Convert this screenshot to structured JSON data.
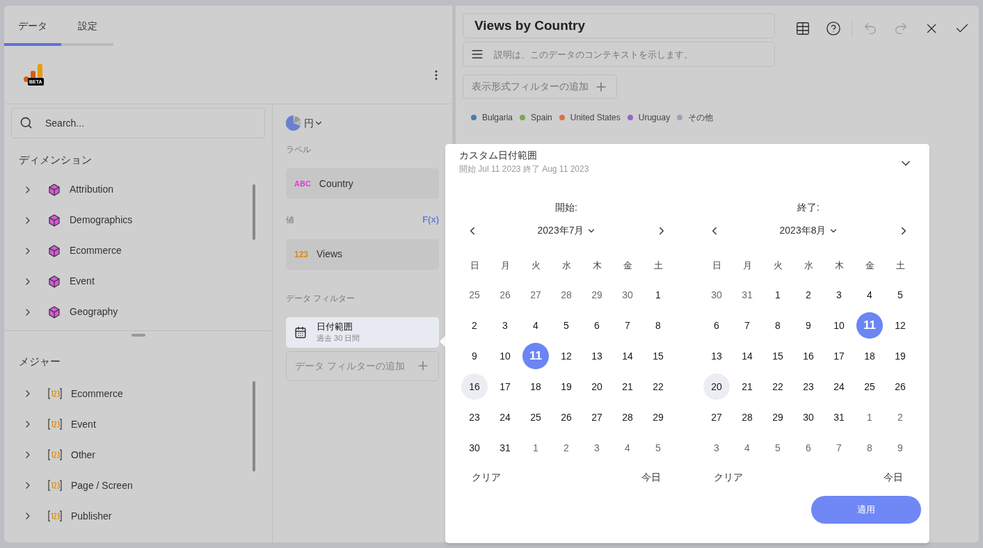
{
  "tabs": [
    {
      "label": "データ",
      "selected": true
    },
    {
      "label": "設定",
      "selected": false
    }
  ],
  "source": {
    "badge": "BETA"
  },
  "search": {
    "placeholder": "Search..."
  },
  "dimensions": {
    "title": "ディメンション",
    "items": [
      {
        "label": "Attribution",
        "expanded": false
      },
      {
        "label": "Demographics",
        "expanded": false
      },
      {
        "label": "Ecommerce",
        "expanded": false
      },
      {
        "label": "Event",
        "expanded": false
      },
      {
        "label": "Geography",
        "expanded": false
      }
    ]
  },
  "measures": {
    "title": "メジャー",
    "items": [
      {
        "label": "Ecommerce",
        "expanded": false
      },
      {
        "label": "Event",
        "expanded": false
      },
      {
        "label": "Other",
        "expanded": false
      },
      {
        "label": "Page / Screen",
        "expanded": false
      },
      {
        "label": "Publisher",
        "expanded": false
      }
    ]
  },
  "chart_type": {
    "label": "円"
  },
  "label_section": {
    "title": "ラベル",
    "field": {
      "type_tag": "ABC",
      "name": "Country"
    }
  },
  "value_section": {
    "title": "値",
    "fx": "F(x)",
    "field": {
      "type_tag": "123",
      "name": "Views"
    }
  },
  "filter_section": {
    "title": "データ フィルター",
    "filter": {
      "name": "日付範囲",
      "detail": "過去 30 日間",
      "selected": true
    },
    "add": "データ フィルターの追加"
  },
  "title_field": {
    "value": "Views by Country"
  },
  "description_field": {
    "placeholder": "説明は、このデータのコンテキストを示します。"
  },
  "toolbar": [
    {
      "kind": "table",
      "disabled": false
    },
    {
      "kind": "help",
      "disabled": false
    },
    {
      "kind": "undo",
      "disabled": true
    },
    {
      "kind": "redo",
      "disabled": true
    },
    {
      "kind": "close",
      "disabled": false
    },
    {
      "kind": "check",
      "disabled": false
    }
  ],
  "visual_filter_button": "表示形式フィルターの追加",
  "legend": [
    {
      "label": "Bulgaria",
      "color": "#4e79b7"
    },
    {
      "label": "Spain",
      "color": "#79a94e"
    },
    {
      "label": "United States",
      "color": "#d9704f"
    },
    {
      "label": "Uruguay",
      "color": "#9468c4"
    },
    {
      "label": "その他",
      "color": "#9aa2b6"
    }
  ],
  "date_popup": {
    "title": "カスタム日付範囲",
    "summary": "開始 Jul 11 2023 終了 Aug 11 2023",
    "apply": "適用",
    "calendars": [
      {
        "heading": "開始:",
        "month": "2023年7月",
        "weekdays": [
          "日",
          "月",
          "火",
          "水",
          "木",
          "金",
          "土"
        ],
        "clear": "クリア",
        "today": "今日",
        "days": [
          {
            "label": "25",
            "outside": true,
            "selected": false,
            "highlighted": false
          },
          {
            "label": "26",
            "outside": true,
            "selected": false,
            "highlighted": false
          },
          {
            "label": "27",
            "outside": true,
            "selected": false,
            "highlighted": false
          },
          {
            "label": "28",
            "outside": true,
            "selected": false,
            "highlighted": false
          },
          {
            "label": "29",
            "outside": true,
            "selected": false,
            "highlighted": false
          },
          {
            "label": "30",
            "outside": true,
            "selected": false,
            "highlighted": false
          },
          {
            "label": "1",
            "outside": false,
            "selected": false,
            "highlighted": false
          },
          {
            "label": "2",
            "outside": false,
            "selected": false,
            "highlighted": false
          },
          {
            "label": "3",
            "outside": false,
            "selected": false,
            "highlighted": false
          },
          {
            "label": "4",
            "outside": false,
            "selected": false,
            "highlighted": false
          },
          {
            "label": "5",
            "outside": false,
            "selected": false,
            "highlighted": false
          },
          {
            "label": "6",
            "outside": false,
            "selected": false,
            "highlighted": false
          },
          {
            "label": "7",
            "outside": false,
            "selected": false,
            "highlighted": false
          },
          {
            "label": "8",
            "outside": false,
            "selected": false,
            "highlighted": false
          },
          {
            "label": "9",
            "outside": false,
            "selected": false,
            "highlighted": false
          },
          {
            "label": "10",
            "outside": false,
            "selected": false,
            "highlighted": false
          },
          {
            "label": "11",
            "outside": false,
            "selected": true,
            "highlighted": false
          },
          {
            "label": "12",
            "outside": false,
            "selected": false,
            "highlighted": false
          },
          {
            "label": "13",
            "outside": false,
            "selected": false,
            "highlighted": false
          },
          {
            "label": "14",
            "outside": false,
            "selected": false,
            "highlighted": false
          },
          {
            "label": "15",
            "outside": false,
            "selected": false,
            "highlighted": false
          },
          {
            "label": "16",
            "outside": false,
            "selected": false,
            "highlighted": true
          },
          {
            "label": "17",
            "outside": false,
            "selected": false,
            "highlighted": false
          },
          {
            "label": "18",
            "outside": false,
            "selected": false,
            "highlighted": false
          },
          {
            "label": "19",
            "outside": false,
            "selected": false,
            "highlighted": false
          },
          {
            "label": "20",
            "outside": false,
            "selected": false,
            "highlighted": false
          },
          {
            "label": "21",
            "outside": false,
            "selected": false,
            "highlighted": false
          },
          {
            "label": "22",
            "outside": false,
            "selected": false,
            "highlighted": false
          },
          {
            "label": "23",
            "outside": false,
            "selected": false,
            "highlighted": false
          },
          {
            "label": "24",
            "outside": false,
            "selected": false,
            "highlighted": false
          },
          {
            "label": "25",
            "outside": false,
            "selected": false,
            "highlighted": false
          },
          {
            "label": "26",
            "outside": false,
            "selected": false,
            "highlighted": false
          },
          {
            "label": "27",
            "outside": false,
            "selected": false,
            "highlighted": false
          },
          {
            "label": "28",
            "outside": false,
            "selected": false,
            "highlighted": false
          },
          {
            "label": "29",
            "outside": false,
            "selected": false,
            "highlighted": false
          },
          {
            "label": "30",
            "outside": false,
            "selected": false,
            "highlighted": false
          },
          {
            "label": "31",
            "outside": false,
            "selected": false,
            "highlighted": false
          },
          {
            "label": "1",
            "outside": true,
            "selected": false,
            "highlighted": false
          },
          {
            "label": "2",
            "outside": true,
            "selected": false,
            "highlighted": false
          },
          {
            "label": "3",
            "outside": true,
            "selected": false,
            "highlighted": false
          },
          {
            "label": "4",
            "outside": true,
            "selected": false,
            "highlighted": false
          },
          {
            "label": "5",
            "outside": true,
            "selected": false,
            "highlighted": false
          }
        ]
      },
      {
        "heading": "終了:",
        "month": "2023年8月",
        "weekdays": [
          "日",
          "月",
          "火",
          "水",
          "木",
          "金",
          "土"
        ],
        "clear": "クリア",
        "today": "今日",
        "days": [
          {
            "label": "30",
            "outside": true,
            "selected": false,
            "highlighted": false
          },
          {
            "label": "31",
            "outside": true,
            "selected": false,
            "highlighted": false
          },
          {
            "label": "1",
            "outside": false,
            "selected": false,
            "highlighted": false
          },
          {
            "label": "2",
            "outside": false,
            "selected": false,
            "highlighted": false
          },
          {
            "label": "3",
            "outside": false,
            "selected": false,
            "highlighted": false
          },
          {
            "label": "4",
            "outside": false,
            "selected": false,
            "highlighted": false
          },
          {
            "label": "5",
            "outside": false,
            "selected": false,
            "highlighted": false
          },
          {
            "label": "6",
            "outside": false,
            "selected": false,
            "highlighted": false
          },
          {
            "label": "7",
            "outside": false,
            "selected": false,
            "highlighted": false
          },
          {
            "label": "8",
            "outside": false,
            "selected": false,
            "highlighted": false
          },
          {
            "label": "9",
            "outside": false,
            "selected": false,
            "highlighted": false
          },
          {
            "label": "10",
            "outside": false,
            "selected": false,
            "highlighted": false
          },
          {
            "label": "11",
            "outside": false,
            "selected": true,
            "highlighted": false
          },
          {
            "label": "12",
            "outside": false,
            "selected": false,
            "highlighted": false
          },
          {
            "label": "13",
            "outside": false,
            "selected": false,
            "highlighted": false
          },
          {
            "label": "14",
            "outside": false,
            "selected": false,
            "highlighted": false
          },
          {
            "label": "15",
            "outside": false,
            "selected": false,
            "highlighted": false
          },
          {
            "label": "16",
            "outside": false,
            "selected": false,
            "highlighted": false
          },
          {
            "label": "17",
            "outside": false,
            "selected": false,
            "highlighted": false
          },
          {
            "label": "18",
            "outside": false,
            "selected": false,
            "highlighted": false
          },
          {
            "label": "19",
            "outside": false,
            "selected": false,
            "highlighted": false
          },
          {
            "label": "20",
            "outside": false,
            "selected": false,
            "highlighted": true
          },
          {
            "label": "21",
            "outside": false,
            "selected": false,
            "highlighted": false
          },
          {
            "label": "22",
            "outside": false,
            "selected": false,
            "highlighted": false
          },
          {
            "label": "23",
            "outside": false,
            "selected": false,
            "highlighted": false
          },
          {
            "label": "24",
            "outside": false,
            "selected": false,
            "highlighted": false
          },
          {
            "label": "25",
            "outside": false,
            "selected": false,
            "highlighted": false
          },
          {
            "label": "26",
            "outside": false,
            "selected": false,
            "highlighted": false
          },
          {
            "label": "27",
            "outside": false,
            "selected": false,
            "highlighted": false
          },
          {
            "label": "28",
            "outside": false,
            "selected": false,
            "highlighted": false
          },
          {
            "label": "29",
            "outside": false,
            "selected": false,
            "highlighted": false
          },
          {
            "label": "30",
            "outside": false,
            "selected": false,
            "highlighted": false
          },
          {
            "label": "31",
            "outside": false,
            "selected": false,
            "highlighted": false
          },
          {
            "label": "1",
            "outside": true,
            "selected": false,
            "highlighted": false
          },
          {
            "label": "2",
            "outside": true,
            "selected": false,
            "highlighted": false
          },
          {
            "label": "3",
            "outside": true,
            "selected": false,
            "highlighted": false
          },
          {
            "label": "4",
            "outside": true,
            "selected": false,
            "highlighted": false
          },
          {
            "label": "5",
            "outside": true,
            "selected": false,
            "highlighted": false
          },
          {
            "label": "6",
            "outside": true,
            "selected": false,
            "highlighted": false
          },
          {
            "label": "7",
            "outside": true,
            "selected": false,
            "highlighted": false
          },
          {
            "label": "8",
            "outside": true,
            "selected": false,
            "highlighted": false
          },
          {
            "label": "9",
            "outside": true,
            "selected": false,
            "highlighted": false
          }
        ]
      }
    ]
  }
}
